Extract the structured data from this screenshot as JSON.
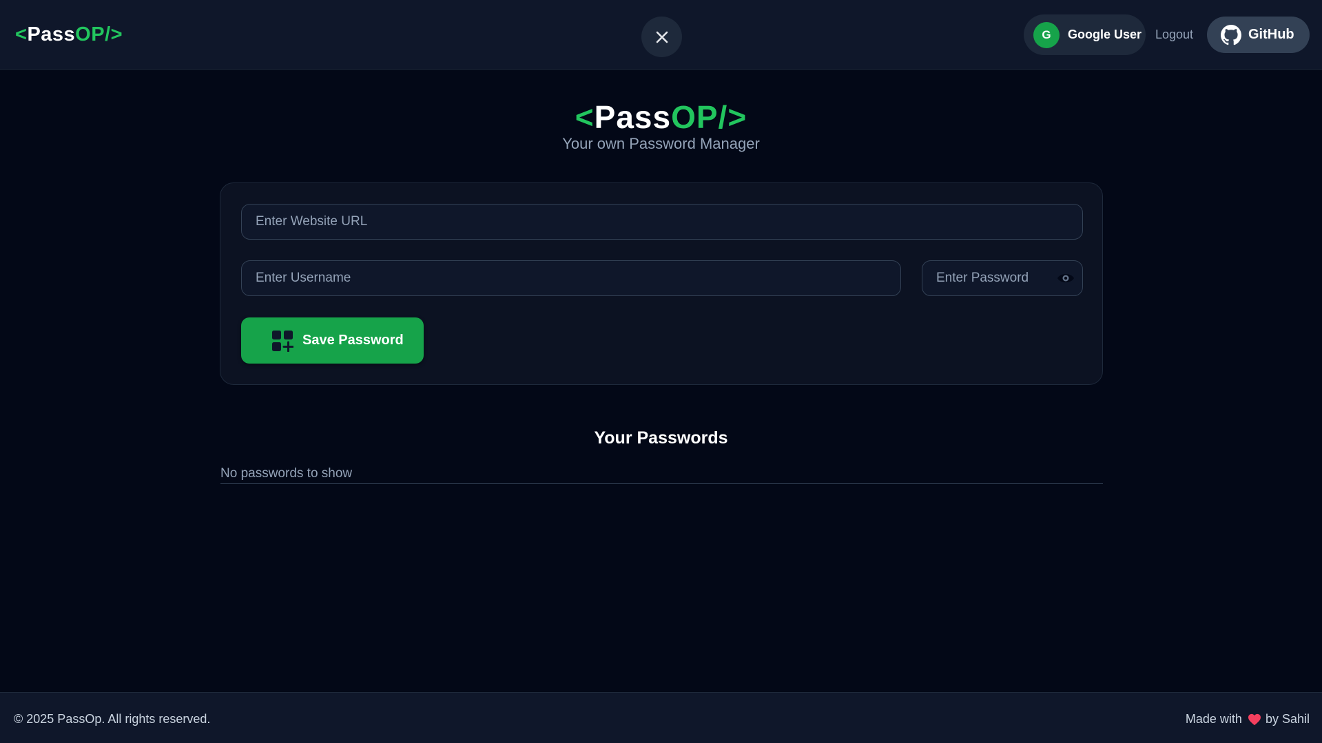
{
  "navbar": {
    "logo": {
      "open": "<",
      "part1": "Pass",
      "part2": "OP/",
      "close": ">"
    },
    "user": {
      "initial": "G",
      "name": "Google User"
    },
    "logout_label": "Logout",
    "github_label": "GitHub"
  },
  "hero": {
    "logo": {
      "open": "<",
      "part1": "Pass",
      "part2": "OP/",
      "close": ">"
    },
    "subtitle": "Your own Password Manager"
  },
  "form": {
    "url_placeholder": "Enter Website URL",
    "url_value": "",
    "username_placeholder": "Enter Username",
    "username_value": "",
    "password_placeholder": "Enter Password",
    "password_value": "",
    "save_label": "Save Password"
  },
  "passwords": {
    "title": "Your Passwords",
    "empty_message": "No passwords to show"
  },
  "footer": {
    "copyright": "© 2025 PassOp. All rights reserved.",
    "made_with_prefix": "Made with",
    "made_with_suffix": "by Sahil"
  },
  "colors": {
    "accent": "#22c55e",
    "background": "#030817",
    "surface": "#0f172a",
    "heart": "#f43f5e"
  },
  "icons": [
    "close-icon",
    "github-icon",
    "eye-icon",
    "add-grid-icon",
    "heart-icon"
  ]
}
